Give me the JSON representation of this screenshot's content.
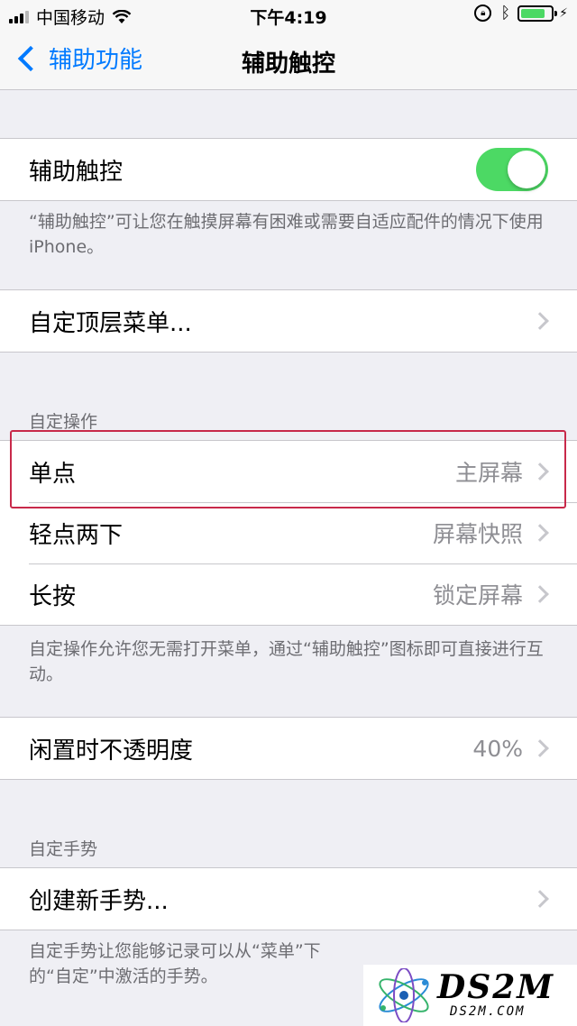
{
  "status_bar": {
    "carrier": "中国移动",
    "time": "下午4:19",
    "battery_level": 0.8,
    "icons": [
      "signal-icon",
      "wifi-icon",
      "rotation-lock-icon",
      "bluetooth-icon",
      "battery-icon",
      "charging-icon"
    ]
  },
  "nav": {
    "back_label": "辅助功能",
    "title": "辅助触控"
  },
  "toggle_group": {
    "label": "辅助触控",
    "enabled": true,
    "footer": "“辅助触控”可让您在触摸屏幕有困难或需要自适应配件的情况下使用 iPhone。"
  },
  "menu_group": {
    "label": "自定顶层菜单..."
  },
  "custom_actions": {
    "header": "自定操作",
    "rows": [
      {
        "label": "单点",
        "value": "主屏幕"
      },
      {
        "label": "轻点两下",
        "value": "屏幕快照"
      },
      {
        "label": "长按",
        "value": "锁定屏幕"
      }
    ],
    "footer": "自定操作允许您无需打开菜单，通过“辅助触控”图标即可直接进行互动。"
  },
  "opacity_group": {
    "label": "闲置时不透明度",
    "value": "40%"
  },
  "gestures": {
    "header": "自定手势",
    "row_label": "创建新手势...",
    "footer": "自定手势让您能够记录可以从“菜单”下的“自定”中激活的手势。"
  },
  "watermark": {
    "brand": "DS2M",
    "domain": "DS2M.COM"
  },
  "colors": {
    "accent": "#007aff",
    "toggle_on": "#4cd964",
    "highlight_border": "#c8294a"
  }
}
